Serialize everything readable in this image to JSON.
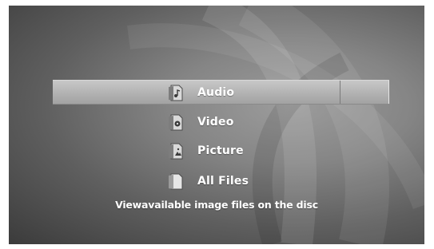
{
  "menu": {
    "items": [
      {
        "label": "Audio",
        "icon": "audio-file-icon",
        "selected": true
      },
      {
        "label": "Video",
        "icon": "video-file-icon",
        "selected": false
      },
      {
        "label": "Picture",
        "icon": "picture-file-icon",
        "selected": false
      },
      {
        "label": "All Files",
        "icon": "all-files-icon",
        "selected": false
      }
    ]
  },
  "help": {
    "text": "Viewavailable image files on the disc"
  },
  "colors": {
    "background_center": "#9c9c9c",
    "background_edge": "#3b3b3b",
    "selection_bar": "#b4b4b4",
    "text": "#ffffff"
  }
}
